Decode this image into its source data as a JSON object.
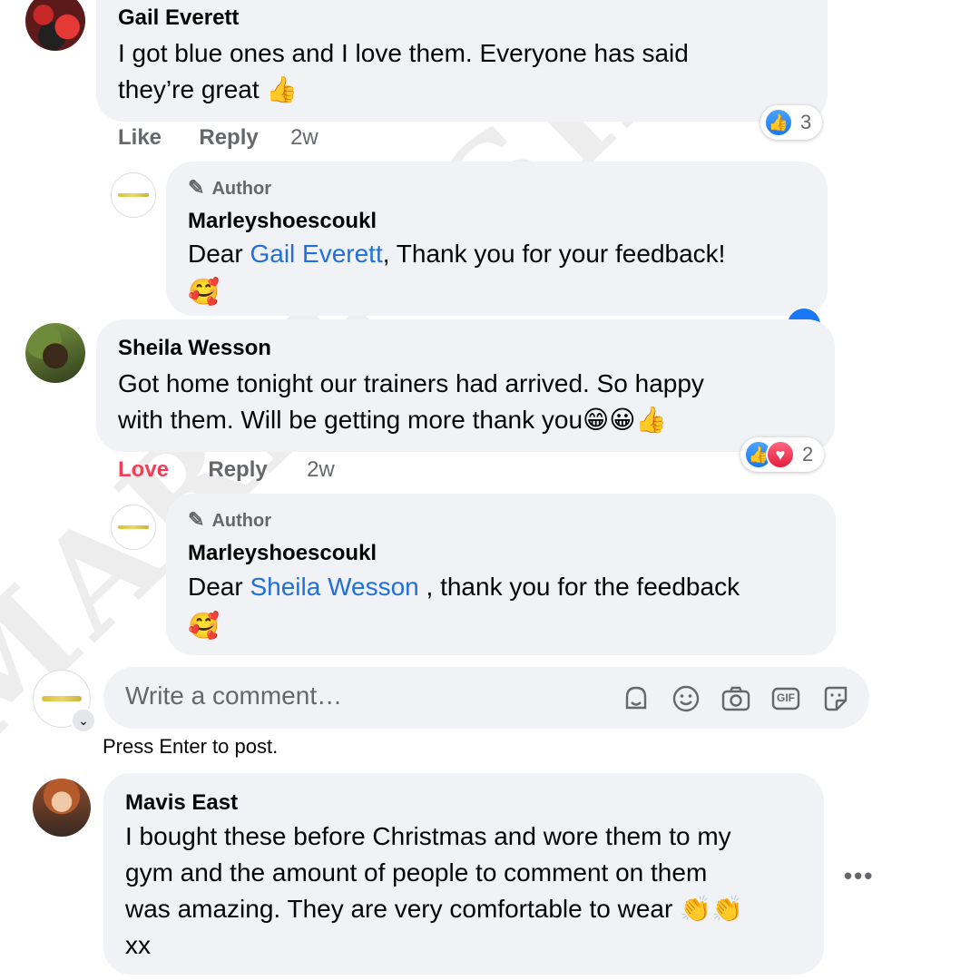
{
  "comments": [
    {
      "author": "Gail Everett",
      "text_line1": "I got blue ones and I love them. Everyone has said",
      "text_line2": "they’re great",
      "emoji": "👍",
      "action_like": "Like",
      "action_reply": "Reply",
      "time": "2w",
      "reaction_count": "3",
      "reply": {
        "badge": "Author",
        "author": "Marleyshoescoukl",
        "prefix": "Dear ",
        "mention": "Gail Everett",
        "suffix": ", Thank you for your feedback!",
        "emoji": "🥰"
      }
    },
    {
      "author": "Sheila Wesson",
      "text_line1": "Got home tonight our trainers had arrived. So happy",
      "text_line2": "with them. Will be getting more thank you",
      "emoji": "😁😀👍",
      "action_like": "Love",
      "action_reply": "Reply",
      "time": "2w",
      "reaction_count": "2",
      "reply": {
        "badge": "Author",
        "author": "Marleyshoescoukl",
        "prefix": "Dear ",
        "mention": "Sheila Wesson",
        "suffix": " , thank you for the feedback",
        "emoji": "🥰"
      }
    },
    {
      "author": "Mavis East",
      "text_line1": "I bought these before Christmas and wore them to my",
      "text_line2": "gym and the amount of people to comment on them",
      "text_line3": "was amazing. They are very comfortable to wear",
      "emoji": "👏👏",
      "text_line4": "xx",
      "more": "•••"
    }
  ],
  "composer": {
    "placeholder": "Write a comment…",
    "hint": "Press Enter to post.",
    "icons": [
      "avatar-sticker-icon",
      "emoji-icon",
      "camera-icon",
      "gif-icon",
      "sticker-icon"
    ],
    "gif_label": "GIF"
  },
  "watermark": "MARLEYSHOES",
  "colors": {
    "bubble": "#f0f2f5",
    "link": "#216fdb",
    "love": "#f33e58",
    "secondary": "#65676b"
  }
}
